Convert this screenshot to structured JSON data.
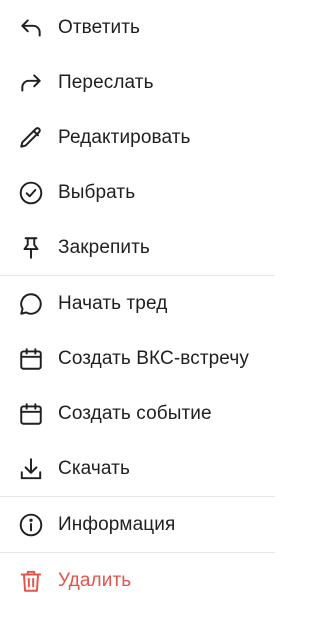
{
  "menu": {
    "groups": [
      {
        "items": [
          {
            "label": "Ответить",
            "icon": "reply-icon"
          },
          {
            "label": "Переслать",
            "icon": "forward-icon"
          },
          {
            "label": "Редактировать",
            "icon": "pencil-icon"
          },
          {
            "label": "Выбрать",
            "icon": "check-circle-icon"
          },
          {
            "label": "Закрепить",
            "icon": "pin-icon"
          }
        ]
      },
      {
        "items": [
          {
            "label": "Начать тред",
            "icon": "chat-bubble-icon"
          },
          {
            "label": "Создать ВКС-встречу",
            "icon": "calendar-icon"
          },
          {
            "label": "Создать событие",
            "icon": "calendar-icon"
          },
          {
            "label": "Скачать",
            "icon": "download-icon"
          }
        ]
      },
      {
        "items": [
          {
            "label": "Информация",
            "icon": "info-icon"
          }
        ]
      },
      {
        "items": [
          {
            "label": "Удалить",
            "icon": "trash-icon"
          }
        ]
      }
    ]
  },
  "colors": {
    "text": "#1f1f1f",
    "danger": "#e5534b",
    "divider": "#e8e8e8",
    "background": "#ffffff"
  }
}
